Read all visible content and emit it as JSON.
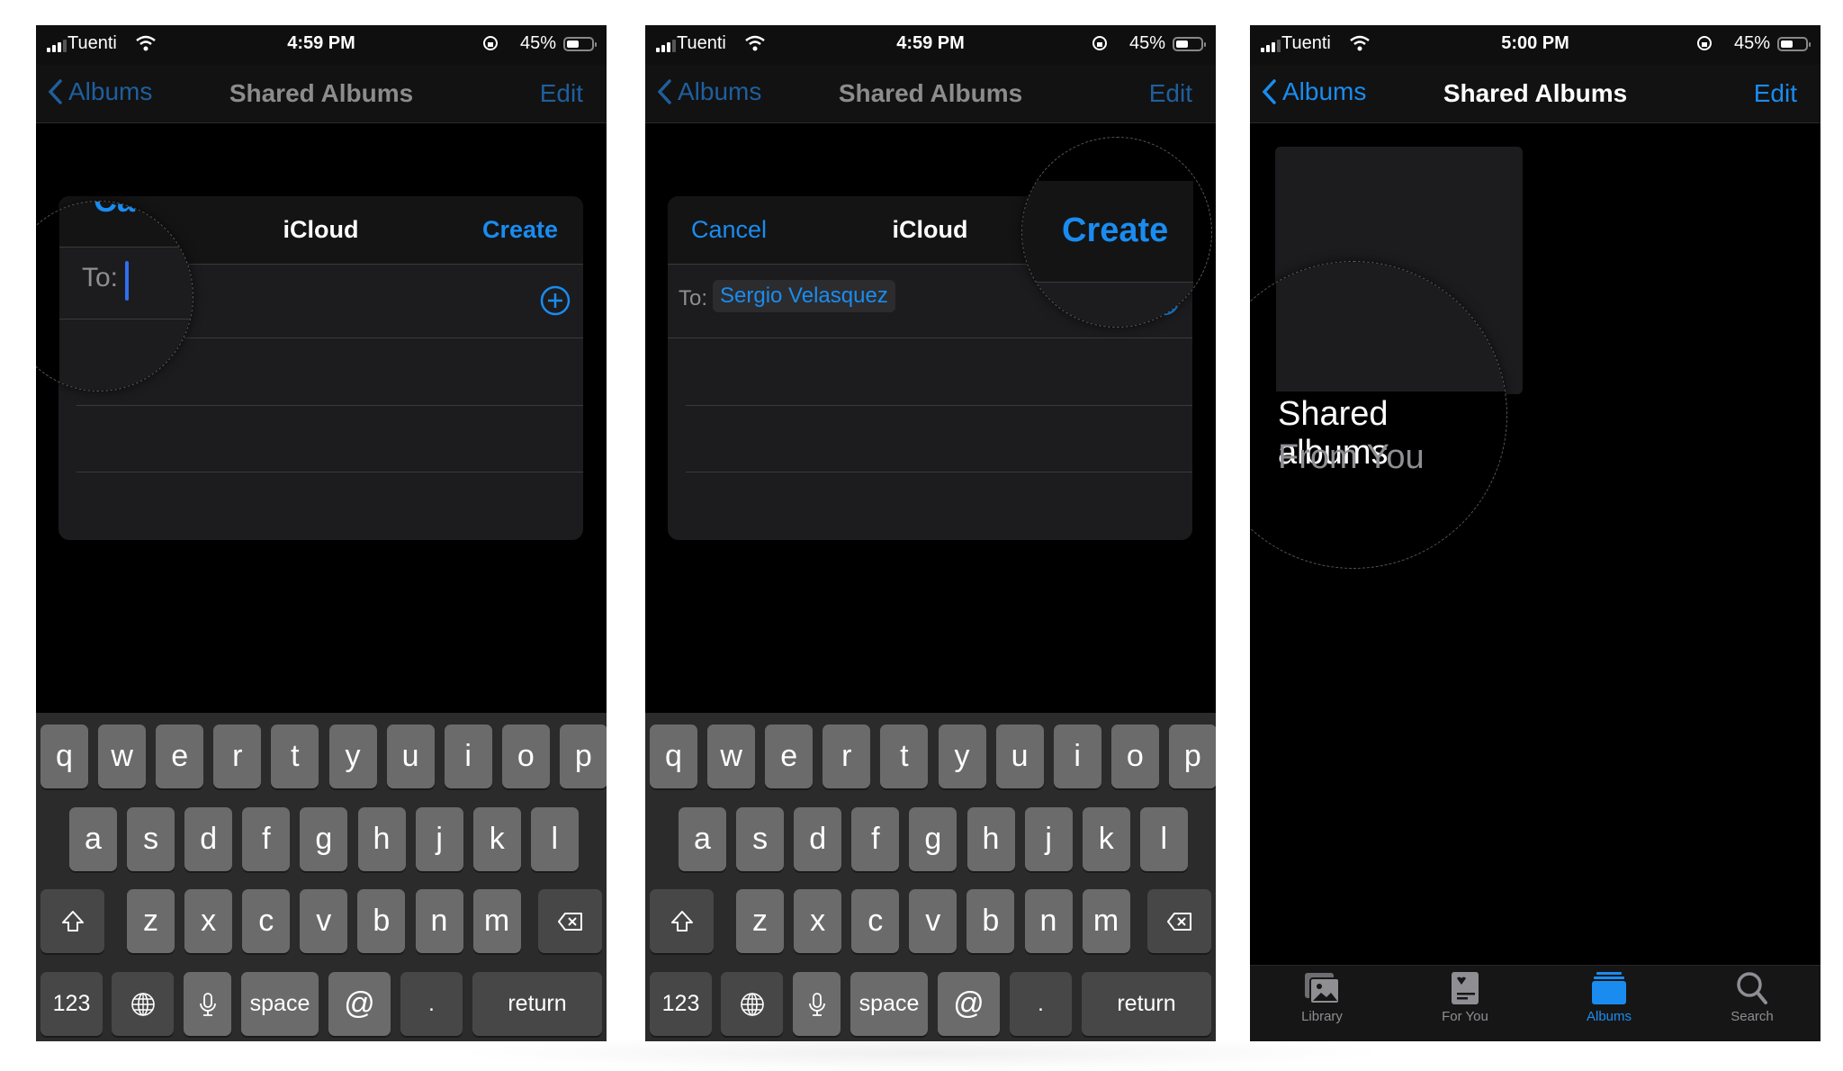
{
  "panels": [
    {
      "status": {
        "carrier": "Tuenti",
        "time": "4:59 PM",
        "battery": "45%"
      },
      "nav": {
        "back": "Albums",
        "title": "Shared Albums",
        "edit": "Edit"
      },
      "dialog": {
        "cancel": "Cancel",
        "title": "iCloud",
        "create": "Create",
        "to_label": "To:",
        "recipient": ""
      },
      "magnifier": {
        "text": "To:",
        "partial_text": "Ca"
      }
    },
    {
      "status": {
        "carrier": "Tuenti",
        "time": "4:59 PM",
        "battery": "45%"
      },
      "nav": {
        "back": "Albums",
        "title": "Shared Albums",
        "edit": "Edit"
      },
      "dialog": {
        "cancel": "Cancel",
        "title": "iCloud",
        "create": "Create",
        "to_label": "To:",
        "recipient": "Sergio Velasquez"
      },
      "magnifier": {
        "text": "Create"
      }
    },
    {
      "status": {
        "carrier": "Tuenti",
        "time": "5:00 PM",
        "battery": "45%"
      },
      "nav": {
        "back": "Albums",
        "title": "Shared Albums",
        "edit": "Edit"
      },
      "album": {
        "title": "Shared albums",
        "subtitle": "From You"
      },
      "tabs": [
        {
          "label": "Library",
          "icon": "photo-library-icon",
          "active": false
        },
        {
          "label": "For You",
          "icon": "for-you-icon",
          "active": false
        },
        {
          "label": "Albums",
          "icon": "albums-icon",
          "active": true
        },
        {
          "label": "Search",
          "icon": "search-icon",
          "active": false
        }
      ]
    }
  ],
  "keyboard": {
    "row1": [
      "q",
      "w",
      "e",
      "r",
      "t",
      "y",
      "u",
      "i",
      "o",
      "p"
    ],
    "row2": [
      "a",
      "s",
      "d",
      "f",
      "g",
      "h",
      "j",
      "k",
      "l"
    ],
    "row3": [
      "z",
      "x",
      "c",
      "v",
      "b",
      "n",
      "m"
    ],
    "numbers": "123",
    "space": "space",
    "at": "@",
    "dot": ".",
    "return": "return"
  },
  "colors": {
    "accent": "#1a8cf0",
    "background": "#000000",
    "keyboard": "#2b2b2b",
    "key": "#6b6b6b"
  }
}
